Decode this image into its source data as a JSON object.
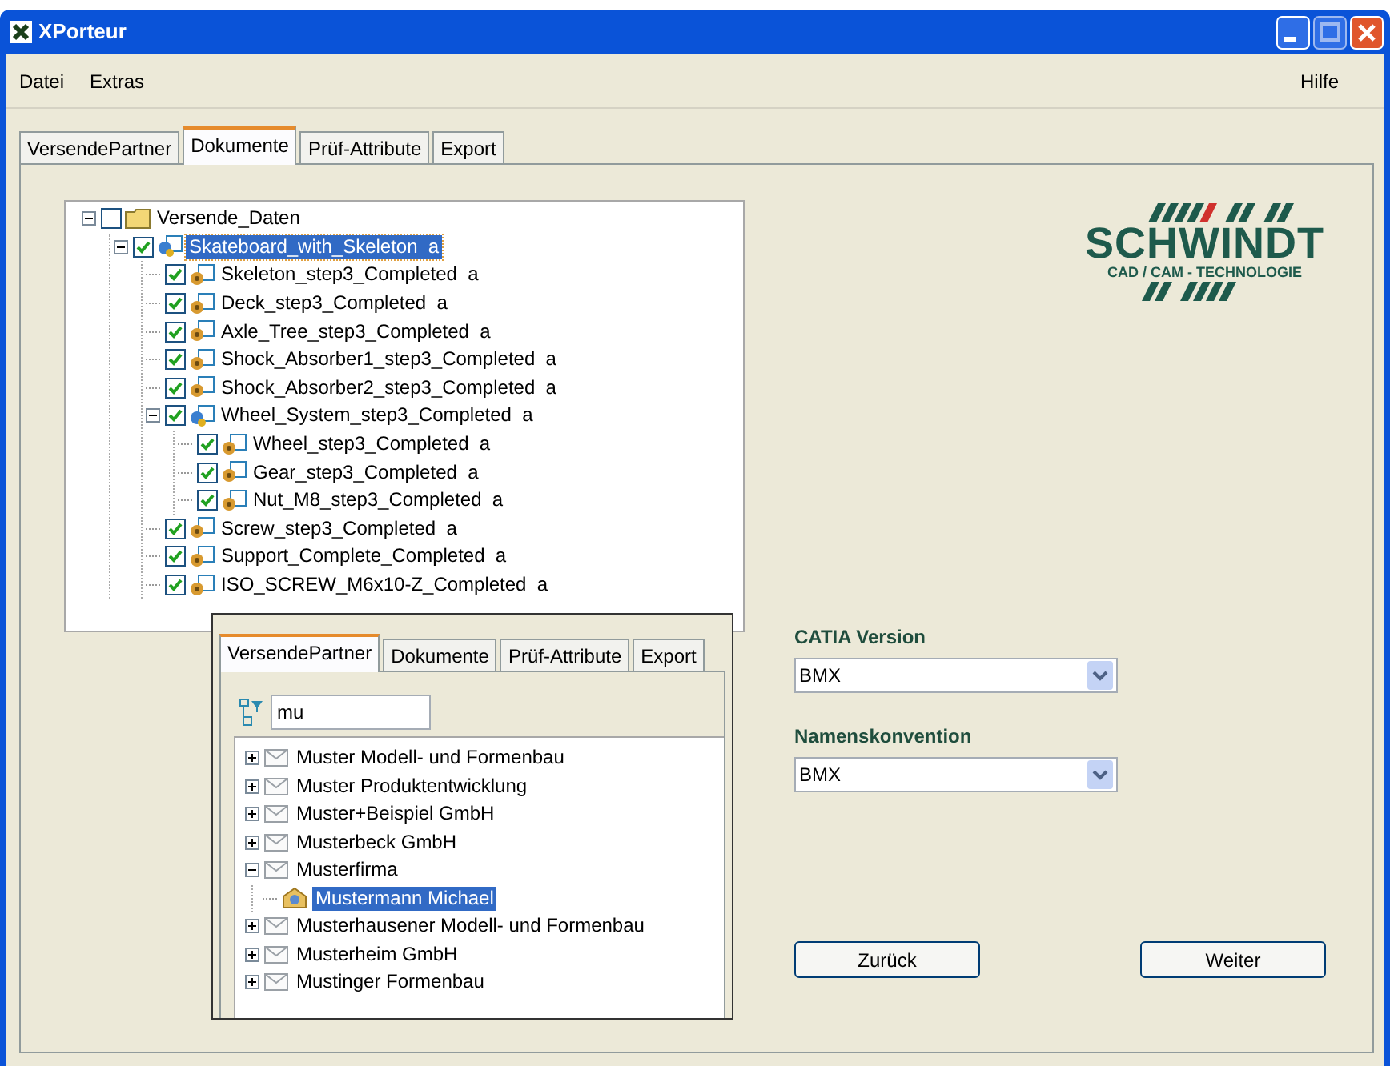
{
  "window": {
    "title": "XPorteur"
  },
  "menu": {
    "left": [
      "Datei",
      "Extras"
    ],
    "right": [
      "Hilfe"
    ]
  },
  "tabs": [
    {
      "label": "VersendePartner",
      "selected": false
    },
    {
      "label": "Dokumente",
      "selected": true
    },
    {
      "label": "Prüf-Attribute",
      "selected": false
    },
    {
      "label": "Export",
      "selected": false
    }
  ],
  "document_tree": [
    {
      "label": "Versende_Daten",
      "kind": "folder",
      "checked": false,
      "selected": false,
      "expanded": true,
      "children": [
        {
          "label": "Skateboard_with_Skeleton  a",
          "kind": "assembly",
          "checked": true,
          "selected": true,
          "expanded": true,
          "children": [
            {
              "label": "Skeleton_step3_Completed  a",
              "kind": "part",
              "checked": true,
              "selected": false
            },
            {
              "label": "Deck_step3_Completed  a",
              "kind": "part",
              "checked": true,
              "selected": false
            },
            {
              "label": "Axle_Tree_step3_Completed  a",
              "kind": "part",
              "checked": true,
              "selected": false
            },
            {
              "label": "Shock_Absorber1_step3_Completed  a",
              "kind": "part",
              "checked": true,
              "selected": false
            },
            {
              "label": "Shock_Absorber2_step3_Completed  a",
              "kind": "part",
              "checked": true,
              "selected": false
            },
            {
              "label": "Wheel_System_step3_Completed  a",
              "kind": "assembly",
              "checked": true,
              "selected": false,
              "expanded": true,
              "children": [
                {
                  "label": "Wheel_step3_Completed  a",
                  "kind": "part",
                  "checked": true,
                  "selected": false
                },
                {
                  "label": "Gear_step3_Completed  a",
                  "kind": "part",
                  "checked": true,
                  "selected": false
                },
                {
                  "label": "Nut_M8_step3_Completed  a",
                  "kind": "part",
                  "checked": true,
                  "selected": false
                }
              ]
            },
            {
              "label": "Screw_step3_Completed  a",
              "kind": "part",
              "checked": true,
              "selected": false
            },
            {
              "label": "Support_Complete_Completed  a",
              "kind": "part",
              "checked": true,
              "selected": false
            },
            {
              "label": "ISO_SCREW_M6x10-Z_Completed  a",
              "kind": "part",
              "checked": true,
              "selected": false
            }
          ]
        }
      ]
    }
  ],
  "logo": {
    "name": "SCHWINDT",
    "tagline": "CAD / CAM - TECHNOLOGIE"
  },
  "catia_version": {
    "label": "CATIA Version",
    "value": "BMX"
  },
  "naming_convention": {
    "label": "Namenskonvention",
    "value": "BMX"
  },
  "buttons": [
    "Zurück",
    "Weiter"
  ],
  "inset_window": {
    "tabs": [
      {
        "label": "VersendePartner",
        "selected": true
      },
      {
        "label": "Dokumente",
        "selected": false
      },
      {
        "label": "Prüf-Attribute",
        "selected": false
      },
      {
        "label": "Export",
        "selected": false
      }
    ],
    "filter": {
      "value": "mu"
    },
    "partner_tree": [
      {
        "label": "Muster Modell- und Formenbau",
        "kind": "company",
        "expanded": false,
        "selected": false
      },
      {
        "label": "Muster Produktentwicklung",
        "kind": "company",
        "expanded": false,
        "selected": false
      },
      {
        "label": "Muster+Beispiel GmbH",
        "kind": "company",
        "expanded": false,
        "selected": false
      },
      {
        "label": "Musterbeck GmbH",
        "kind": "company",
        "expanded": false,
        "selected": false
      },
      {
        "label": "Musterfirma",
        "kind": "company",
        "expanded": true,
        "selected": false,
        "children": [
          {
            "label": "Mustermann Michael",
            "kind": "person",
            "selected": true
          }
        ]
      },
      {
        "label": "Musterhausener Modell- und Formenbau",
        "kind": "company",
        "expanded": false,
        "selected": false
      },
      {
        "label": "Musterheim GmbH",
        "kind": "company",
        "expanded": false,
        "selected": false
      },
      {
        "label": "Mustinger Formenbau",
        "kind": "company",
        "expanded": false,
        "selected": false
      }
    ]
  }
}
